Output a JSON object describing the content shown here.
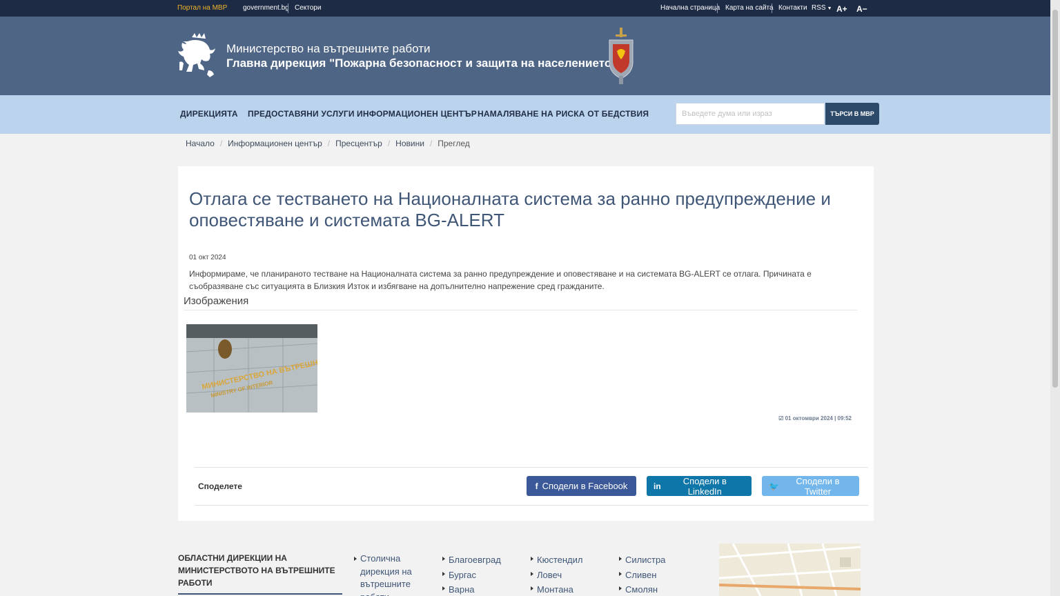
{
  "topbar": {
    "portal": "Портал на МВР",
    "government": "government.bg",
    "sectors": "Сектори",
    "home": "Начална страница",
    "sitemap": "Карта на сайта",
    "contacts": "Контакти",
    "rss": "RSS",
    "font_increase": "A+",
    "font_decrease": "A−"
  },
  "header": {
    "line1": "Министерство на вътрешните работи",
    "line2": "Главна дирекция \"Пожарна безопасност и защита на населението\"",
    "logo_icon": "lion-logo-icon",
    "crest_icon": "fire-service-crest-icon"
  },
  "nav": {
    "items": [
      "ДИРЕКЦИЯТА",
      "ПРЕДОСТАВЯНИ УСЛУГИ",
      "ИНФОРМАЦИОНЕН ЦЕНТЪР",
      "НАМАЛЯВАНЕ НА РИСКА ОТ БЕДСТВИЯ"
    ],
    "search_placeholder": "Въведете дума или израз",
    "search_button": "ТЪРСИ В МВР"
  },
  "breadcrumb": [
    "Начало",
    "Информационен център",
    "Пресцентър",
    "Новини",
    "Преглед"
  ],
  "article": {
    "title": "Отлага се тестването на Националната система за ранно предупреждение и оповестяване и системата BG-ALERT",
    "date": "01 окт 2024",
    "body": "Информираме, че планираното тестване на Националната система за ранно предупреждение и оповестяване и на системата BG-ALERT се отлага. Причината е съобразяване със ситуацията в Близкия Изток и избягване на допълнително напрежение сред гражданите.",
    "images_heading": "Изображения",
    "photo_text_1": "МИНИСТЕРСТВО НА ВЪТРЕШНИТЕ РАБОТИ",
    "photo_text_2": "MINISTRY OF INTERIOR",
    "timestamp": "01 октомври 2024 | 09:52"
  },
  "share": {
    "label": "Споделете",
    "facebook": "Сподели в Facebook",
    "linkedin": "Сподели в LinkedIn",
    "twitter": "Сподели в Twitter"
  },
  "footer": {
    "title": "ОБЛАСТНИ ДИРЕКЦИИ НА МИНИСТЕРСТВОТО НА ВЪТРЕШНИТЕ РАБОТИ",
    "col1": [
      "Столична дирекция на вътрешните работи"
    ],
    "col2": [
      "Благоевград",
      "Бургас",
      "Варна"
    ],
    "col3": [
      "Кюстендил",
      "Ловеч",
      "Монтана"
    ],
    "col4": [
      "Силистра",
      "Сливен",
      "Смолян"
    ]
  },
  "colors": {
    "topbar": "#1d2b45",
    "header": "#4e6585",
    "navbar": "#bcd3ee",
    "accent": "#3f5677",
    "facebook": "#3b5998",
    "linkedin": "#0e76a8",
    "twitter": "#72b6eb"
  }
}
